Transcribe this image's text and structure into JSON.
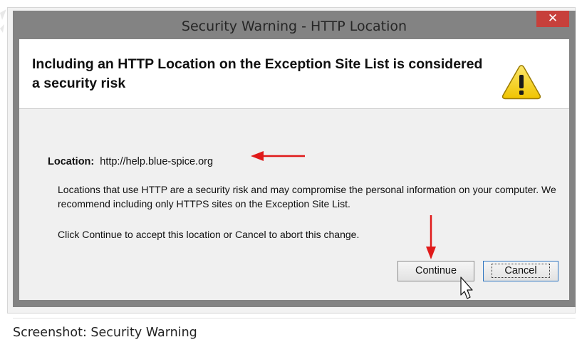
{
  "window": {
    "title": "Security Warning - HTTP Location",
    "close_symbol": "✕"
  },
  "header": {
    "text": "Including an HTTP Location on the Exception Site List is considered a security risk",
    "icon": "warning-triangle-icon"
  },
  "location": {
    "label": "Location:",
    "value": "http://help.blue-spice.org"
  },
  "paragraphs": {
    "risk": "Locations that use HTTP are a security risk and may compromise the personal information on your computer.  We recommend including only HTTPS sites on the Exception Site List.",
    "instruction": "Click Continue to accept this location or Cancel to abort this change."
  },
  "buttons": {
    "continue_label": "Continue",
    "cancel_label": "Cancel"
  },
  "caption": "Screenshot: Security Warning",
  "colors": {
    "window_frame": "#838383",
    "close_button": "#c7403b",
    "annotation_arrow": "#e01a1a",
    "warning_yellow": "#f7d21f"
  }
}
